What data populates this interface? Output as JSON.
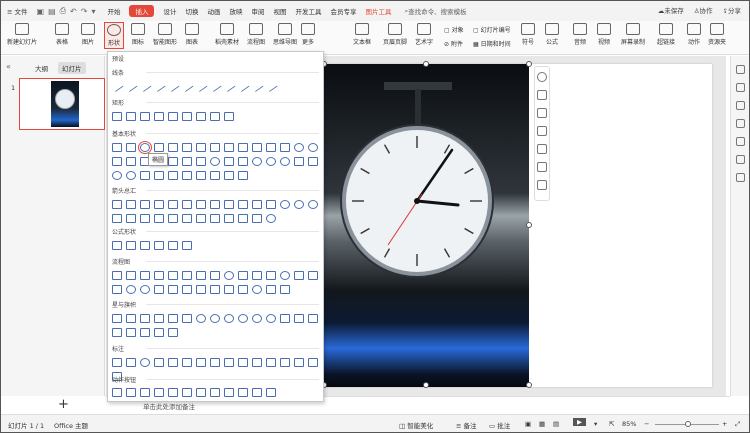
{
  "menubar": {
    "file_label": "文件",
    "items": [
      "开始",
      "插入",
      "设计",
      "切换",
      "动画",
      "放映",
      "审阅",
      "视图",
      "开发工具",
      "会员专享"
    ],
    "active": "插入",
    "picture_tools": "图片工具",
    "search_placeholder": "查找命令、搜索模板",
    "right": [
      "未保存",
      "协作",
      "分享"
    ]
  },
  "ribbon": {
    "buttons": [
      {
        "label": "新建幻灯片"
      },
      {
        "label": "表格"
      },
      {
        "label": "图片"
      },
      {
        "label": "形状"
      },
      {
        "label": "图标"
      },
      {
        "label": "智能图形"
      },
      {
        "label": "图表"
      },
      {
        "label": "稻壳素材"
      },
      {
        "label": "流程图"
      },
      {
        "label": "思维导图"
      },
      {
        "label": "更多"
      },
      {
        "label": "文本框"
      },
      {
        "label": "页眉页脚"
      },
      {
        "label": "艺术字"
      },
      {
        "label": "符号"
      },
      {
        "label": "公式"
      },
      {
        "label": "音频"
      },
      {
        "label": "视频"
      },
      {
        "label": "屏幕录制"
      },
      {
        "label": "超链接"
      },
      {
        "label": "动作"
      },
      {
        "label": "资源夹"
      }
    ],
    "small": [
      {
        "label": "对象"
      },
      {
        "label": "幻灯片编号"
      },
      {
        "label": "附件"
      },
      {
        "label": "日期和时间"
      }
    ]
  },
  "left_panel": {
    "tabs": [
      "大纲",
      "幻灯片"
    ],
    "active_tab": "幻灯片",
    "slide_number": "1"
  },
  "shapes_dropdown": {
    "header": "预设",
    "sections": [
      "线条",
      "矩形",
      "基本形状",
      "箭头总汇",
      "公式形状",
      "流程图",
      "星与旗帜",
      "标注",
      "动作按钮"
    ],
    "tooltip": "椭圆"
  },
  "notes": {
    "placeholder": "单击此处添加备注"
  },
  "status": {
    "slide_info": "幻灯片 1 / 1",
    "theme": "Office 主题",
    "smart_beautify": "智能美化",
    "notes_btn": "备注",
    "comments_btn": "批注",
    "zoom": "85%"
  },
  "colors": {
    "accent": "#e3483a",
    "shape_stroke": "#4a6fb0"
  },
  "icons": [
    "doc-icon",
    "shape-icon",
    "image-icon",
    "play-icon",
    "add-slide-icon",
    "zoom-in-icon",
    "crop-icon",
    "expand-icon"
  ]
}
